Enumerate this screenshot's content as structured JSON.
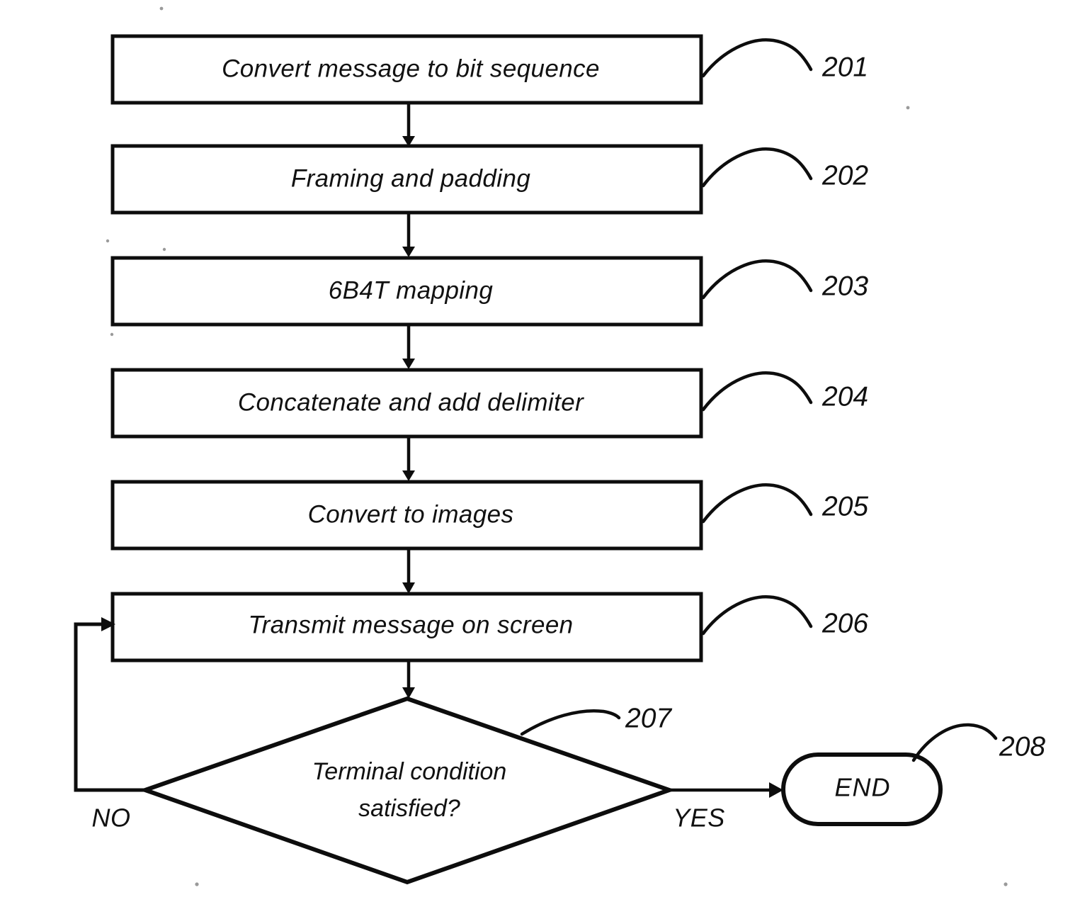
{
  "figure": {
    "type": "patent-flowchart",
    "steps": [
      {
        "id": "201",
        "label": "Convert message to bit sequence",
        "ref": "201"
      },
      {
        "id": "202",
        "label": "Framing and padding",
        "ref": "202"
      },
      {
        "id": "203",
        "label": "6B4T mapping",
        "ref": "203"
      },
      {
        "id": "204",
        "label": "Concatenate and add delimiter",
        "ref": "204"
      },
      {
        "id": "205",
        "label": "Convert to images",
        "ref": "205"
      },
      {
        "id": "206",
        "label": "Transmit message on screen",
        "ref": "206"
      }
    ],
    "decision": {
      "id": "207",
      "ref": "207",
      "label_line1": "Terminal condition",
      "label_line2": "satisfied?",
      "no_label": "NO",
      "yes_label": "YES"
    },
    "terminal": {
      "id": "208",
      "ref": "208",
      "label": "END"
    },
    "colors": {
      "ink": "#0d0d0d",
      "paper": "#ffffff"
    }
  }
}
